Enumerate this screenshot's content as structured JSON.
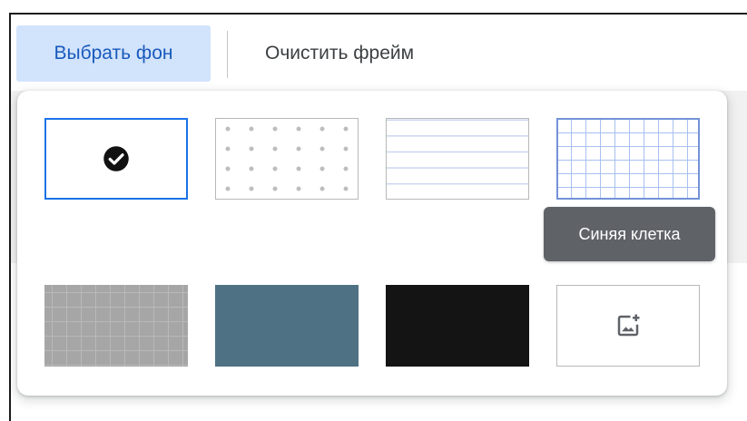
{
  "toolbar": {
    "choose_background_label": "Выбрать фон",
    "clear_frame_label": "Очистить фрейм"
  },
  "background_picker": {
    "options": [
      {
        "name": "blank",
        "selected": true,
        "icon": "check-circle-icon"
      },
      {
        "name": "dots",
        "selected": false
      },
      {
        "name": "lines",
        "selected": false
      },
      {
        "name": "blue-grid",
        "selected": false
      },
      {
        "name": "gray-grid",
        "selected": false
      },
      {
        "name": "slate",
        "selected": false
      },
      {
        "name": "black",
        "selected": false
      },
      {
        "name": "upload-image",
        "selected": false,
        "icon": "add-photo-icon"
      }
    ],
    "tooltip": "Синяя клетка"
  },
  "colors": {
    "selected_button_bg": "#d2e3fc",
    "selected_button_text": "#185abc",
    "selection_border": "#1a73e8",
    "tooltip_bg": "#5f6368",
    "slate_swatch": "#4e7283",
    "black_swatch": "#141414"
  }
}
